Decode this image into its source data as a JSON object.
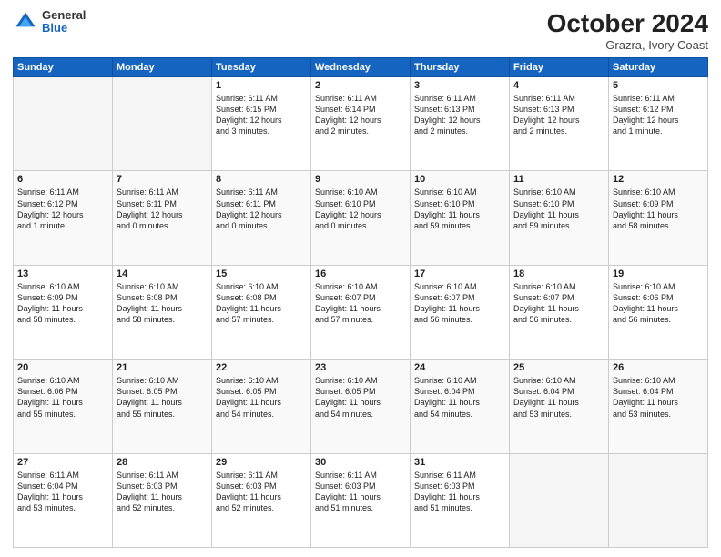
{
  "header": {
    "logo": {
      "general": "General",
      "blue": "Blue"
    },
    "title": "October 2024",
    "subtitle": "Grazra, Ivory Coast"
  },
  "weekdays": [
    "Sunday",
    "Monday",
    "Tuesday",
    "Wednesday",
    "Thursday",
    "Friday",
    "Saturday"
  ],
  "weeks": [
    [
      {
        "day": "",
        "info": ""
      },
      {
        "day": "",
        "info": ""
      },
      {
        "day": "1",
        "info": "Sunrise: 6:11 AM\nSunset: 6:15 PM\nDaylight: 12 hours\nand 3 minutes."
      },
      {
        "day": "2",
        "info": "Sunrise: 6:11 AM\nSunset: 6:14 PM\nDaylight: 12 hours\nand 2 minutes."
      },
      {
        "day": "3",
        "info": "Sunrise: 6:11 AM\nSunset: 6:13 PM\nDaylight: 12 hours\nand 2 minutes."
      },
      {
        "day": "4",
        "info": "Sunrise: 6:11 AM\nSunset: 6:13 PM\nDaylight: 12 hours\nand 2 minutes."
      },
      {
        "day": "5",
        "info": "Sunrise: 6:11 AM\nSunset: 6:12 PM\nDaylight: 12 hours\nand 1 minute."
      }
    ],
    [
      {
        "day": "6",
        "info": "Sunrise: 6:11 AM\nSunset: 6:12 PM\nDaylight: 12 hours\nand 1 minute."
      },
      {
        "day": "7",
        "info": "Sunrise: 6:11 AM\nSunset: 6:11 PM\nDaylight: 12 hours\nand 0 minutes."
      },
      {
        "day": "8",
        "info": "Sunrise: 6:11 AM\nSunset: 6:11 PM\nDaylight: 12 hours\nand 0 minutes."
      },
      {
        "day": "9",
        "info": "Sunrise: 6:10 AM\nSunset: 6:10 PM\nDaylight: 12 hours\nand 0 minutes."
      },
      {
        "day": "10",
        "info": "Sunrise: 6:10 AM\nSunset: 6:10 PM\nDaylight: 11 hours\nand 59 minutes."
      },
      {
        "day": "11",
        "info": "Sunrise: 6:10 AM\nSunset: 6:10 PM\nDaylight: 11 hours\nand 59 minutes."
      },
      {
        "day": "12",
        "info": "Sunrise: 6:10 AM\nSunset: 6:09 PM\nDaylight: 11 hours\nand 58 minutes."
      }
    ],
    [
      {
        "day": "13",
        "info": "Sunrise: 6:10 AM\nSunset: 6:09 PM\nDaylight: 11 hours\nand 58 minutes."
      },
      {
        "day": "14",
        "info": "Sunrise: 6:10 AM\nSunset: 6:08 PM\nDaylight: 11 hours\nand 58 minutes."
      },
      {
        "day": "15",
        "info": "Sunrise: 6:10 AM\nSunset: 6:08 PM\nDaylight: 11 hours\nand 57 minutes."
      },
      {
        "day": "16",
        "info": "Sunrise: 6:10 AM\nSunset: 6:07 PM\nDaylight: 11 hours\nand 57 minutes."
      },
      {
        "day": "17",
        "info": "Sunrise: 6:10 AM\nSunset: 6:07 PM\nDaylight: 11 hours\nand 56 minutes."
      },
      {
        "day": "18",
        "info": "Sunrise: 6:10 AM\nSunset: 6:07 PM\nDaylight: 11 hours\nand 56 minutes."
      },
      {
        "day": "19",
        "info": "Sunrise: 6:10 AM\nSunset: 6:06 PM\nDaylight: 11 hours\nand 56 minutes."
      }
    ],
    [
      {
        "day": "20",
        "info": "Sunrise: 6:10 AM\nSunset: 6:06 PM\nDaylight: 11 hours\nand 55 minutes."
      },
      {
        "day": "21",
        "info": "Sunrise: 6:10 AM\nSunset: 6:05 PM\nDaylight: 11 hours\nand 55 minutes."
      },
      {
        "day": "22",
        "info": "Sunrise: 6:10 AM\nSunset: 6:05 PM\nDaylight: 11 hours\nand 54 minutes."
      },
      {
        "day": "23",
        "info": "Sunrise: 6:10 AM\nSunset: 6:05 PM\nDaylight: 11 hours\nand 54 minutes."
      },
      {
        "day": "24",
        "info": "Sunrise: 6:10 AM\nSunset: 6:04 PM\nDaylight: 11 hours\nand 54 minutes."
      },
      {
        "day": "25",
        "info": "Sunrise: 6:10 AM\nSunset: 6:04 PM\nDaylight: 11 hours\nand 53 minutes."
      },
      {
        "day": "26",
        "info": "Sunrise: 6:10 AM\nSunset: 6:04 PM\nDaylight: 11 hours\nand 53 minutes."
      }
    ],
    [
      {
        "day": "27",
        "info": "Sunrise: 6:11 AM\nSunset: 6:04 PM\nDaylight: 11 hours\nand 53 minutes."
      },
      {
        "day": "28",
        "info": "Sunrise: 6:11 AM\nSunset: 6:03 PM\nDaylight: 11 hours\nand 52 minutes."
      },
      {
        "day": "29",
        "info": "Sunrise: 6:11 AM\nSunset: 6:03 PM\nDaylight: 11 hours\nand 52 minutes."
      },
      {
        "day": "30",
        "info": "Sunrise: 6:11 AM\nSunset: 6:03 PM\nDaylight: 11 hours\nand 51 minutes."
      },
      {
        "day": "31",
        "info": "Sunrise: 6:11 AM\nSunset: 6:03 PM\nDaylight: 11 hours\nand 51 minutes."
      },
      {
        "day": "",
        "info": ""
      },
      {
        "day": "",
        "info": ""
      }
    ]
  ]
}
